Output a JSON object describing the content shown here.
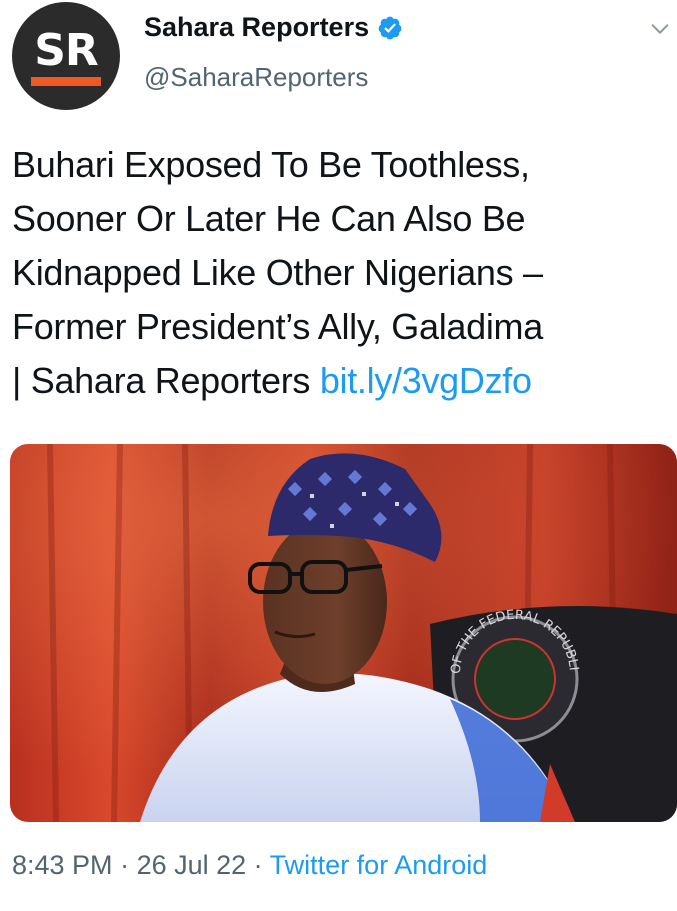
{
  "author": {
    "avatar_text": "SR",
    "display_name": "Sahara Reporters",
    "handle": "@SaharaReporters",
    "verified": true
  },
  "tweet": {
    "text": "Buhari Exposed To Be Toothless,\nSooner Or Later He Can Also Be\nKidnapped Like Other Nigerians –\nFormer President’s Ally, Galadima\n| Sahara Reporters  ",
    "link": "bit.ly/3vgDzfo"
  },
  "media": {
    "icon": "photo",
    "seal_text": "OF THE FEDERAL REPUBLIC"
  },
  "footer": {
    "time": "8:43 PM",
    "separator": " · ",
    "date": "26 Jul 22",
    "source": "Twitter for Android"
  },
  "colors": {
    "link": "#1d9bf0",
    "muted": "#536471",
    "text": "#0f1419",
    "brand_orange": "#ef5a24",
    "verified": "#1d9bf0"
  },
  "icons": {
    "verified": "verified-badge-icon",
    "more": "chevron-down-icon"
  }
}
